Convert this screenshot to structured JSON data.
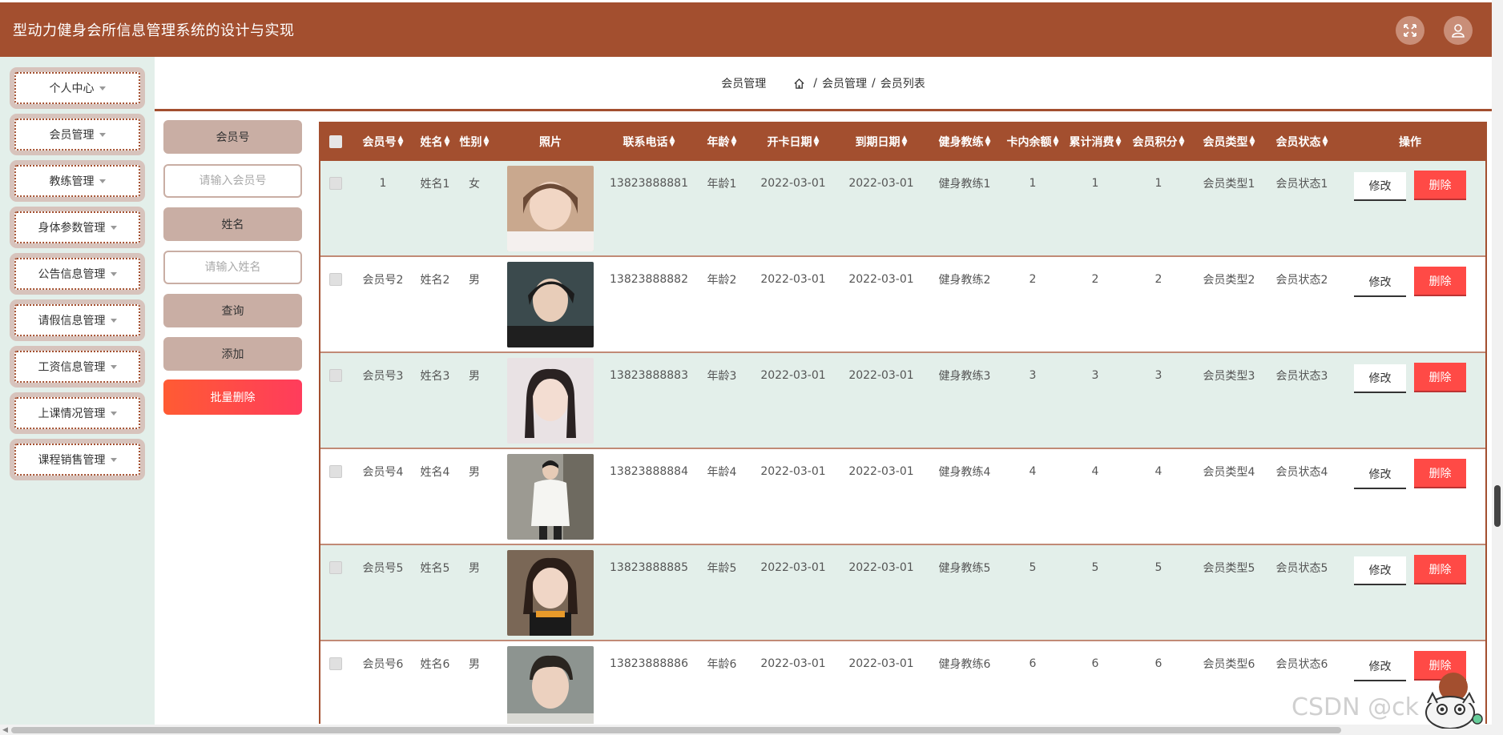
{
  "header": {
    "title": "型动力健身会所信息管理系统的设计与实现",
    "fullscreen_icon": "fullscreen-icon",
    "user_icon": "user-icon"
  },
  "sidebar": {
    "items": [
      {
        "label": "个人中心"
      },
      {
        "label": "会员管理"
      },
      {
        "label": "教练管理"
      },
      {
        "label": "身体参数管理"
      },
      {
        "label": "公告信息管理"
      },
      {
        "label": "请假信息管理"
      },
      {
        "label": "工资信息管理"
      },
      {
        "label": "上课情况管理"
      },
      {
        "label": "课程销售管理"
      }
    ]
  },
  "breadcrumb": {
    "current": "会员管理",
    "home_icon": "home-icon",
    "path": [
      "会员管理",
      "会员列表"
    ],
    "separator": "/"
  },
  "search": {
    "member_no_label": "会员号",
    "member_no_placeholder": "请输入会员号",
    "name_label": "姓名",
    "name_placeholder": "请输入姓名",
    "query_button": "查询",
    "add_button": "添加",
    "bulk_delete_button": "批量删除"
  },
  "table": {
    "columns": [
      "会员号",
      "姓名",
      "性别",
      "照片",
      "联系电话",
      "年龄",
      "开卡日期",
      "到期日期",
      "健身教练",
      "卡内余额",
      "累计消费",
      "会员积分",
      "会员类型",
      "会员状态",
      "操作"
    ],
    "edit_label": "修改",
    "delete_label": "删除",
    "rows": [
      {
        "member_no": "1",
        "name": "姓名1",
        "gender": "女",
        "phone": "13823888881",
        "age": "年龄1",
        "open_date": "2022-03-01",
        "expire_date": "2022-03-01",
        "coach": "健身教练1",
        "balance": "1",
        "total_spent": "1",
        "points": "1",
        "type": "会员类型1",
        "status": "会员状态1"
      },
      {
        "member_no": "会员号2",
        "name": "姓名2",
        "gender": "男",
        "phone": "13823888882",
        "age": "年龄2",
        "open_date": "2022-03-01",
        "expire_date": "2022-03-01",
        "coach": "健身教练2",
        "balance": "2",
        "total_spent": "2",
        "points": "2",
        "type": "会员类型2",
        "status": "会员状态2"
      },
      {
        "member_no": "会员号3",
        "name": "姓名3",
        "gender": "男",
        "phone": "13823888883",
        "age": "年龄3",
        "open_date": "2022-03-01",
        "expire_date": "2022-03-01",
        "coach": "健身教练3",
        "balance": "3",
        "total_spent": "3",
        "points": "3",
        "type": "会员类型3",
        "status": "会员状态3"
      },
      {
        "member_no": "会员号4",
        "name": "姓名4",
        "gender": "男",
        "phone": "13823888884",
        "age": "年龄4",
        "open_date": "2022-03-01",
        "expire_date": "2022-03-01",
        "coach": "健身教练4",
        "balance": "4",
        "total_spent": "4",
        "points": "4",
        "type": "会员类型4",
        "status": "会员状态4"
      },
      {
        "member_no": "会员号5",
        "name": "姓名5",
        "gender": "男",
        "phone": "13823888885",
        "age": "年龄5",
        "open_date": "2022-03-01",
        "expire_date": "2022-03-01",
        "coach": "健身教练5",
        "balance": "5",
        "total_spent": "5",
        "points": "5",
        "type": "会员类型5",
        "status": "会员状态5"
      },
      {
        "member_no": "会员号6",
        "name": "姓名6",
        "gender": "男",
        "phone": "13823888886",
        "age": "年龄6",
        "open_date": "2022-03-01",
        "expire_date": "2022-03-01",
        "coach": "健身教练6",
        "balance": "6",
        "total_spent": "6",
        "points": "6",
        "type": "会员类型6",
        "status": "会员状态6"
      }
    ]
  },
  "watermark": "CSDN @ck",
  "colors": {
    "brand": "#a34f2f",
    "sidebar_bg": "#e3efea",
    "search_label_bg": "#c9aea4",
    "danger": "#ff4a46",
    "row_alt": "#e3efea"
  }
}
